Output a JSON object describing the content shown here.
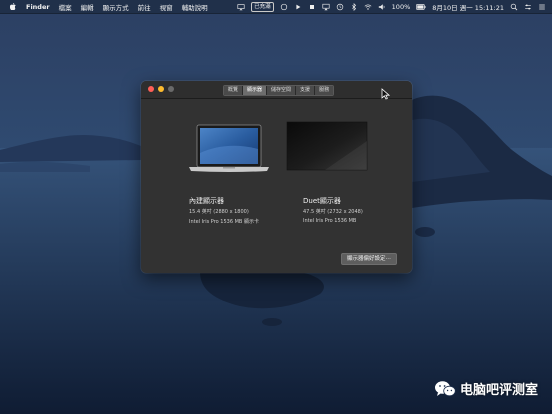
{
  "menubar": {
    "items": [
      "Finder",
      "檔案",
      "編輯",
      "顯示方式",
      "前往",
      "視窗",
      "輔助說明"
    ],
    "status": {
      "connected": "已充滿",
      "battery": "100%",
      "datetime": "8月10日 週一  15:11:21"
    }
  },
  "window": {
    "tabs": [
      "概覽",
      "顯示器",
      "儲存空間",
      "支援",
      "服務"
    ],
    "active_tab": "顯示器",
    "displays": [
      {
        "name": "內建顯示器",
        "resolution": "15.4 英吋 (2880 x 1800)",
        "gpu": "Intel Iris Pro 1536 MB 顯示卡"
      },
      {
        "name": "Duet顯示器",
        "resolution": "47.5 英吋 (2732 x 2048)",
        "gpu": "Intel Iris Pro 1536 MB"
      }
    ],
    "prefs_button": "顯示器偏好設定⋯"
  },
  "watermark": {
    "text": "电脑吧评测室"
  },
  "colors": {
    "close": "#ff5f57",
    "minimize": "#febc2e",
    "zoom": "#6a6a6a"
  }
}
